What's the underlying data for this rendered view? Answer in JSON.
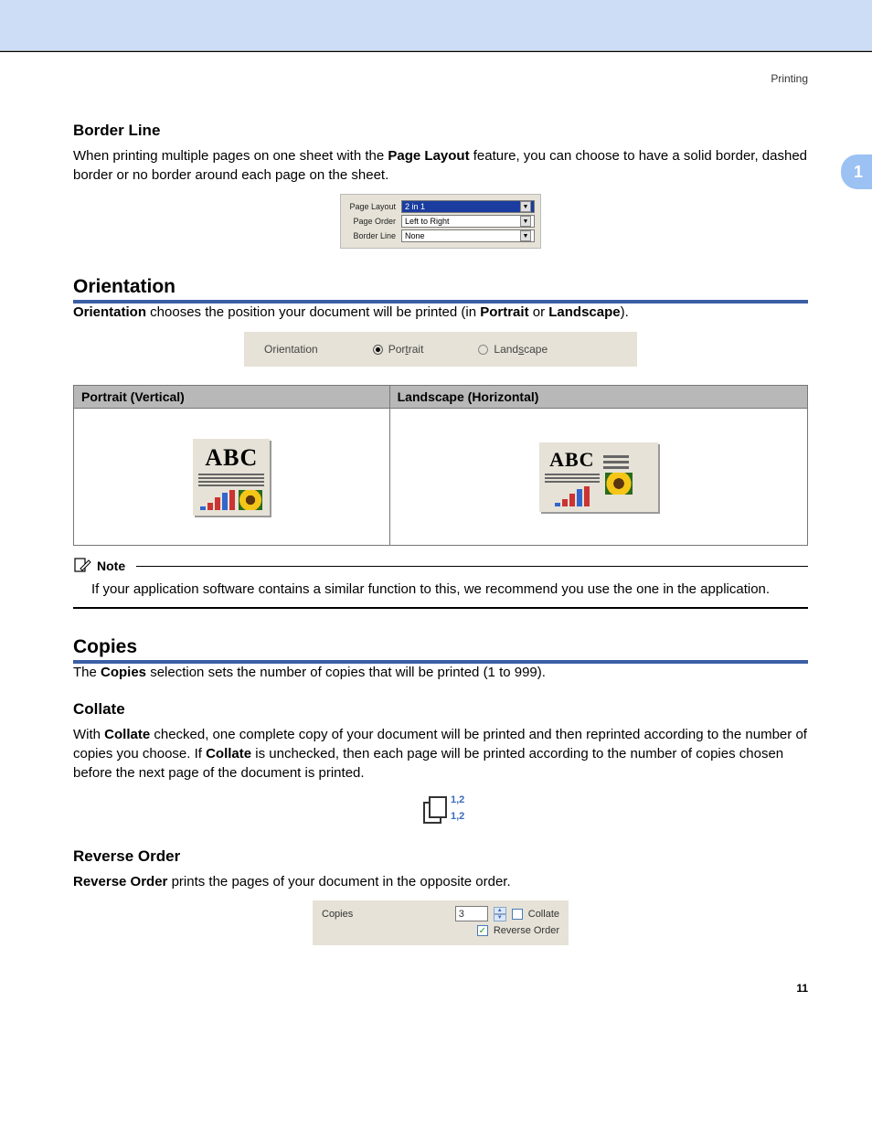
{
  "header": {
    "section_label": "Printing",
    "chapter": "1"
  },
  "border_line": {
    "title": "Border Line",
    "text_pre": "When printing multiple pages on one sheet with the ",
    "text_bold1": "Page Layout",
    "text_post": " feature, you can choose to have a solid border, dashed border or no border around each page on the sheet."
  },
  "page_layout_fig": {
    "row1_label": "Page Layout",
    "row1_value": "2 in 1",
    "row2_label": "Page Order",
    "row2_value": "Left to Right",
    "row3_label": "Border Line",
    "row3_value": "None"
  },
  "orientation": {
    "title": "Orientation",
    "text_b1": "Orientation",
    "text_mid": " chooses the position your document will be printed (in ",
    "text_b2": "Portrait",
    "text_or": " or ",
    "text_b3": "Landscape",
    "text_end": ").",
    "fig_label": "Orientation",
    "opt_portrait": "Portrait",
    "opt_landscape": "Landscape",
    "th_portrait": "Portrait (Vertical)",
    "th_landscape": "Landscape (Horizontal)",
    "doc_abc": "ABC"
  },
  "note": {
    "heading": "Note",
    "text": "If your application software contains a similar function to this, we recommend you use the one in the application."
  },
  "copies": {
    "title": "Copies",
    "text_pre": "The ",
    "text_b": "Copies",
    "text_post": " selection sets the number of copies that will be printed (1 to 999)."
  },
  "collate": {
    "title": "Collate",
    "t1": "With ",
    "b1": "Collate",
    "t2": " checked, one complete copy of your document will be printed and then reprinted according to the number of copies you choose. If ",
    "b2": "Collate",
    "t3": " is unchecked, then each page will be printed according to the number of copies chosen before the next page of the document is printed.",
    "icon_label_top": "1,2",
    "icon_label_bottom": "1,2"
  },
  "reverse": {
    "title": "Reverse Order",
    "b": "Reverse Order",
    "t": " prints the pages of your document in the opposite order."
  },
  "copies_fig": {
    "label": "Copies",
    "value": "3",
    "collate_label": "Collate",
    "reverse_label": "Reverse Order",
    "check": "✓"
  },
  "pagenum": "11"
}
